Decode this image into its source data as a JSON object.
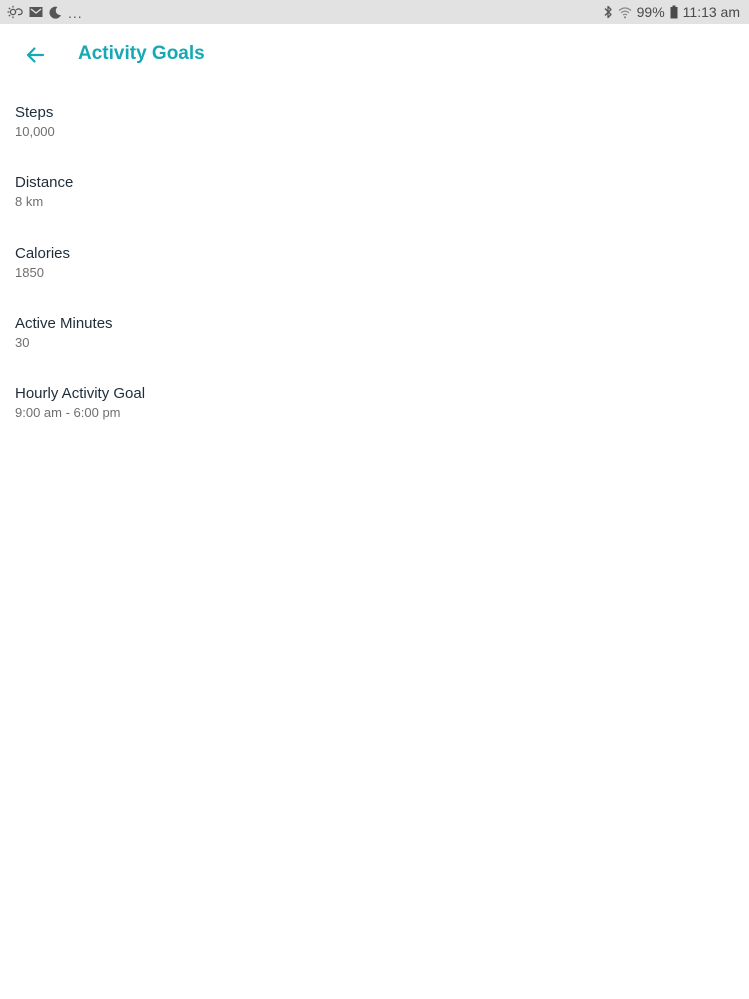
{
  "status_bar": {
    "icons_left": [
      "brightness-icon",
      "mail-icon",
      "moon-icon"
    ],
    "overflow": "...",
    "icons_right": [
      "bluetooth-icon",
      "wifi-icon",
      "battery-icon"
    ],
    "battery": "99%",
    "time": "11:13 am"
  },
  "header": {
    "back_icon": "arrow-left-icon",
    "title": "Activity Goals"
  },
  "colors": {
    "accent": "#16a9b5",
    "status_bar_bg": "#e2e2e2",
    "label_text": "#1e2d3a",
    "value_text": "#6f6f6f"
  },
  "goals": [
    {
      "label": "Steps",
      "value": "10,000"
    },
    {
      "label": "Distance",
      "value": "8 km"
    },
    {
      "label": "Calories",
      "value": "1850"
    },
    {
      "label": "Active Minutes",
      "value": "30"
    },
    {
      "label": "Hourly Activity Goal",
      "value": "9:00 am - 6:00 pm"
    }
  ]
}
